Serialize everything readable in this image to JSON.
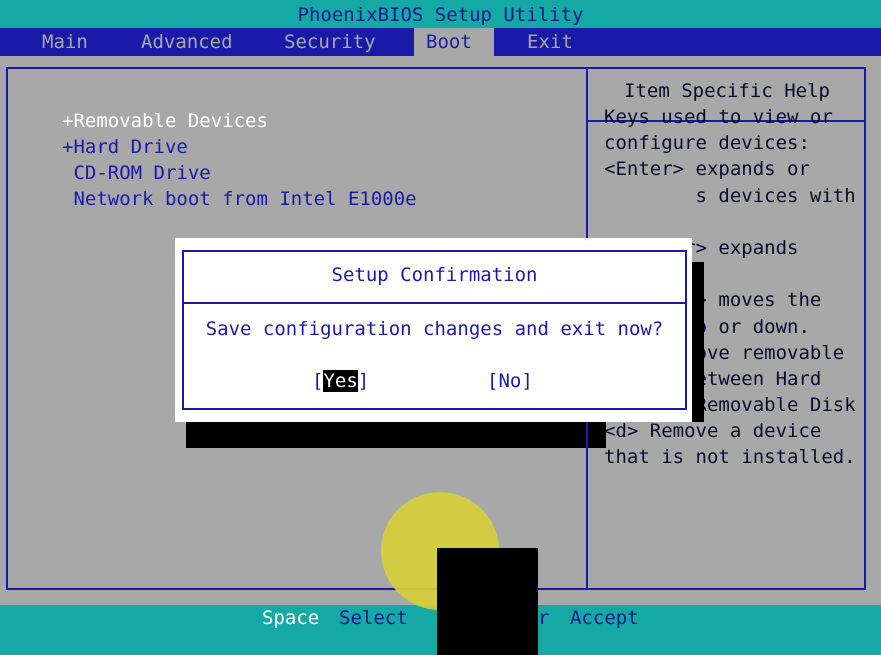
{
  "title": "PhoenixBIOS Setup Utility",
  "menu": [
    {
      "label": "Main"
    },
    {
      "label": "Advanced"
    },
    {
      "label": "Security"
    },
    {
      "label": "Boot"
    },
    {
      "label": "Exit"
    }
  ],
  "boot_list": [
    {
      "label": "+Removable Devices"
    },
    {
      "label": "+Hard Drive"
    },
    {
      "label": " CD-ROM Drive"
    },
    {
      "label": " Network boot from Intel E1000e"
    }
  ],
  "help": {
    "title": "Item Specific Help",
    "lines": [
      "Keys used to view or",
      "configure devices:",
      "<Enter> expands or",
      "        s devices with",
      "",
      "      er> expands",
      "",
      "      <-> moves the",
      "        p or down.",
      "        ove removable",
      "device between Hard",
      "Disk or Removable Disk",
      "<d> Remove a device",
      "that is not installed."
    ]
  },
  "dialog": {
    "title": "Setup Confirmation",
    "message": "Save configuration changes and exit now?",
    "yes_open": "[",
    "yes_text": "Yes",
    "yes_close": "]",
    "no_label": "[No]"
  },
  "status": {
    "space_key": "Space",
    "select_label": "Select",
    "r_label": "r",
    "accept_label": "Accept"
  },
  "colors": {
    "bios_blue": "#1a1aa8",
    "bios_teal": "#15a9a6",
    "bios_gray": "#a8a8a8",
    "highlight_yellow": "#d6cf3a"
  }
}
